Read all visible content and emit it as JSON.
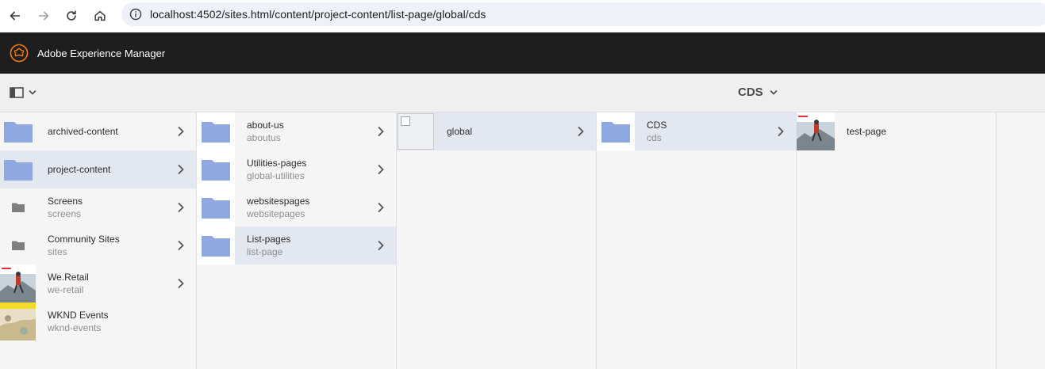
{
  "browser": {
    "url": "localhost:4502/sites.html/content/project-content/list-page/global/cds"
  },
  "app": {
    "title": "Adobe Experience Manager",
    "logo_icon": "aem-logo-icon",
    "accent": "#f07b1d"
  },
  "toolbar": {
    "breadcrumb": "CDS"
  },
  "columns": [
    {
      "items": [
        {
          "title": "archived-content",
          "subtitle": "",
          "icon": "folder-icon",
          "has_children": true,
          "active": false
        },
        {
          "title": "project-content",
          "subtitle": "",
          "icon": "folder-icon",
          "has_children": true,
          "active": true
        },
        {
          "title": "Screens",
          "subtitle": "screens",
          "icon": "small-folder-icon",
          "has_children": true,
          "active": false
        },
        {
          "title": "Community Sites",
          "subtitle": "sites",
          "icon": "small-folder-icon",
          "has_children": true,
          "active": false
        },
        {
          "title": "We.Retail",
          "subtitle": "we-retail",
          "icon": "we-retail-thumbnail",
          "has_children": true,
          "active": false
        },
        {
          "title": "WKND Events",
          "subtitle": "wknd-events",
          "icon": "wknd-thumbnail",
          "has_children": false,
          "active": false
        }
      ]
    },
    {
      "items": [
        {
          "title": "about-us",
          "subtitle": "aboutus",
          "icon": "folder-icon",
          "has_children": true,
          "active": false
        },
        {
          "title": "Utilities-pages",
          "subtitle": "global-utilities",
          "icon": "folder-icon",
          "has_children": true,
          "active": false
        },
        {
          "title": "websitespages",
          "subtitle": "websitepages",
          "icon": "folder-icon",
          "has_children": true,
          "active": false
        },
        {
          "title": "List-pages",
          "subtitle": "list-page",
          "icon": "folder-icon",
          "has_children": true,
          "active": true
        }
      ]
    },
    {
      "items": [
        {
          "title": "global",
          "subtitle": "",
          "icon": "broken-image-icon",
          "has_children": true,
          "active": true
        }
      ]
    },
    {
      "items": [
        {
          "title": "CDS",
          "subtitle": "cds",
          "icon": "folder-icon",
          "has_children": true,
          "active": true
        }
      ]
    },
    {
      "items": [
        {
          "title": "test-page",
          "subtitle": "",
          "icon": "page-thumbnail",
          "has_children": false,
          "active": false
        }
      ]
    }
  ]
}
